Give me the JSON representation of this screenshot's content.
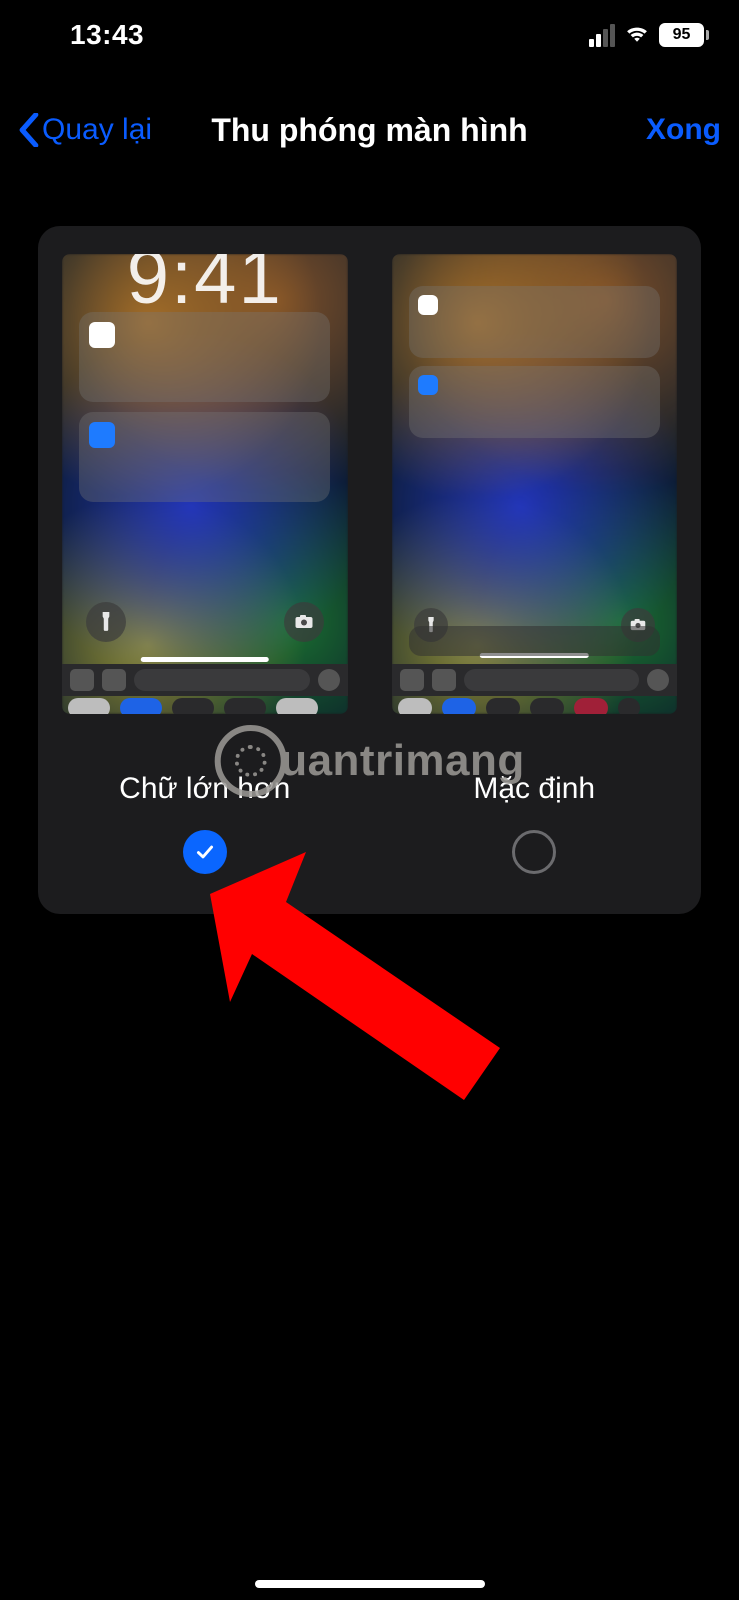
{
  "status": {
    "time": "13:43",
    "battery_pct": "95"
  },
  "nav": {
    "back_label": "Quay lại",
    "title": "Thu phóng màn hình",
    "done_label": "Xong"
  },
  "options": {
    "larger": {
      "label": "Chữ lớn hơn",
      "selected": true
    },
    "default": {
      "label": "Mặc định",
      "selected": false
    }
  },
  "watermark": {
    "text": "uantrimang"
  },
  "colors": {
    "accent": "#0a5cff",
    "panel": "#1c1c1e"
  }
}
